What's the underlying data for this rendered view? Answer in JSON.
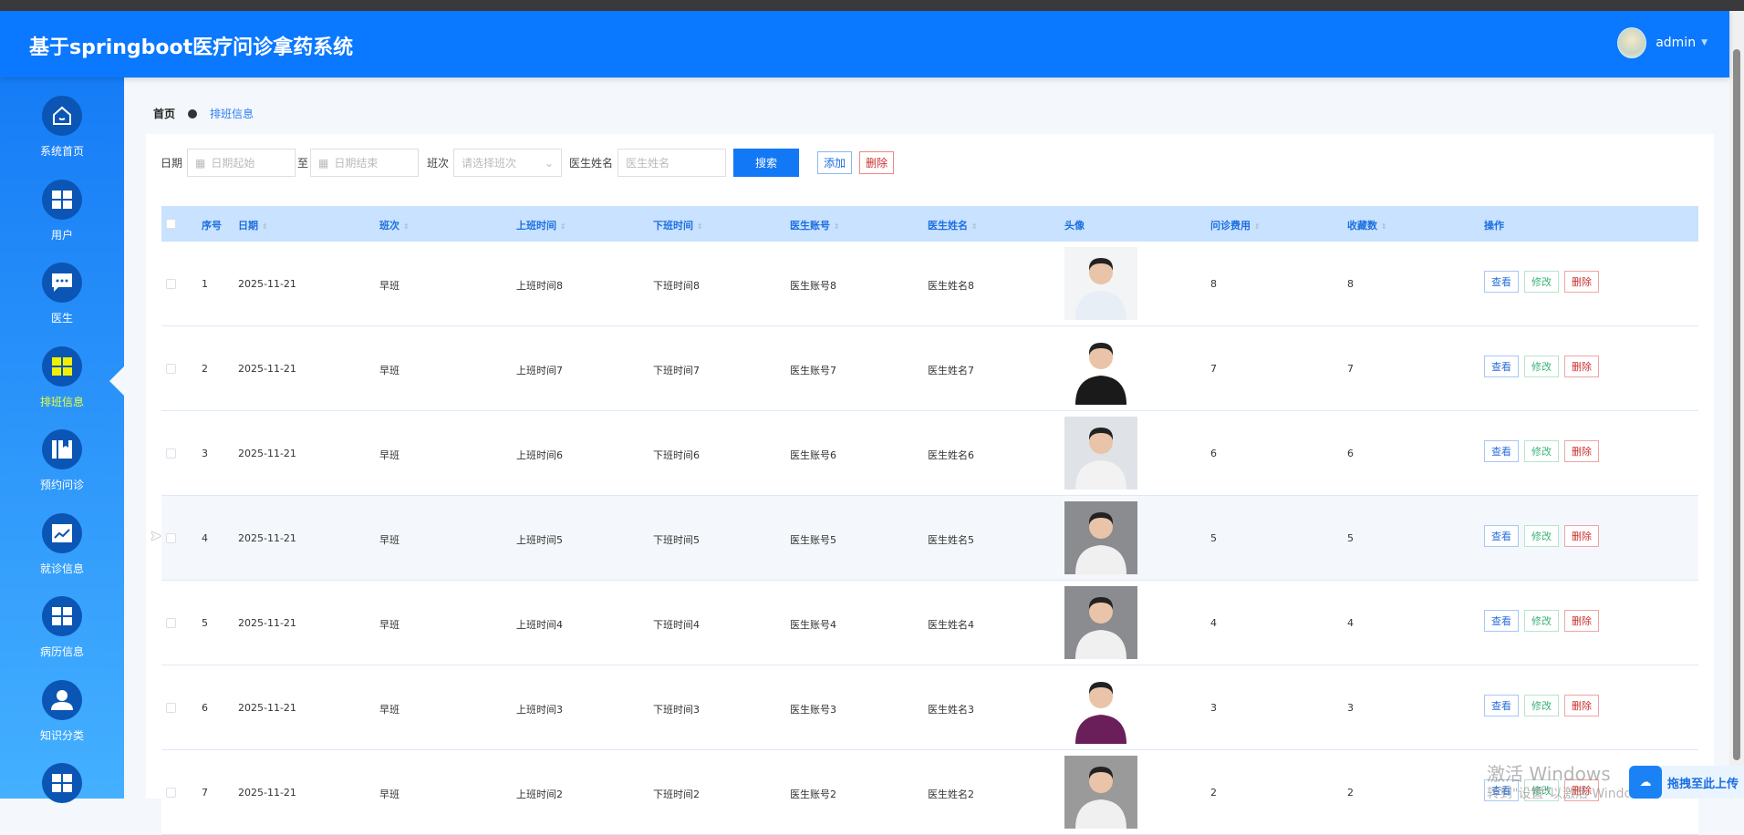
{
  "app_title": "基于springboot医疗问诊拿药系统",
  "user": {
    "name": "admin"
  },
  "sidebar": {
    "items": [
      {
        "label": "系统首页",
        "icon": "home-icon"
      },
      {
        "label": "用户",
        "icon": "grid-icon"
      },
      {
        "label": "医生",
        "icon": "chat-icon"
      },
      {
        "label": "排班信息",
        "icon": "grid-icon",
        "active": true
      },
      {
        "label": "预约问诊",
        "icon": "book-icon"
      },
      {
        "label": "就诊信息",
        "icon": "chart-icon"
      },
      {
        "label": "病历信息",
        "icon": "grid-icon"
      },
      {
        "label": "知识分类",
        "icon": "person-icon"
      },
      {
        "label": "",
        "icon": "grid-icon"
      }
    ]
  },
  "breadcrumb": {
    "home": "首页",
    "current": "排班信息"
  },
  "search": {
    "date_label": "日期",
    "date_start_placeholder": "日期起始",
    "to": "至",
    "date_end_placeholder": "日期结束",
    "shift_label": "班次",
    "shift_placeholder": "请选择班次",
    "doctor_label": "医生姓名",
    "doctor_placeholder": "医生姓名",
    "search_btn": "搜索",
    "add_btn": "添加",
    "delete_btn": "删除"
  },
  "table": {
    "headers": [
      "序号",
      "日期",
      "班次",
      "上班时间",
      "下班时间",
      "医生账号",
      "医生姓名",
      "头像",
      "问诊费用",
      "收藏数",
      "操作"
    ],
    "actions": {
      "view": "查看",
      "edit": "修改",
      "delete": "删除"
    },
    "rows": [
      [
        "1",
        "2025-11-21",
        "早班",
        "上班时间8",
        "下班时间8",
        "医生账号8",
        "医生姓名8",
        "8",
        "8"
      ],
      [
        "2",
        "2025-11-21",
        "早班",
        "上班时间7",
        "下班时间7",
        "医生账号7",
        "医生姓名7",
        "7",
        "7"
      ],
      [
        "3",
        "2025-11-21",
        "早班",
        "上班时间6",
        "下班时间6",
        "医生账号6",
        "医生姓名6",
        "6",
        "6"
      ],
      [
        "4",
        "2025-11-21",
        "早班",
        "上班时间5",
        "下班时间5",
        "医生账号5",
        "医生姓名5",
        "5",
        "5"
      ],
      [
        "5",
        "2025-11-21",
        "早班",
        "上班时间4",
        "下班时间4",
        "医生账号4",
        "医生姓名4",
        "4",
        "4"
      ],
      [
        "6",
        "2025-11-21",
        "早班",
        "上班时间3",
        "下班时间3",
        "医生账号3",
        "医生姓名3",
        "3",
        "3"
      ],
      [
        "7",
        "2025-11-21",
        "早班",
        "上班时间2",
        "下班时间2",
        "医生账号2",
        "医生姓名2",
        "2",
        "2"
      ]
    ]
  },
  "overlay": {
    "watermark1": "激活 Windows",
    "watermark2": "转到\"设置\"以激活 Windows。",
    "upload": "拖拽至此上传"
  },
  "colors": {
    "header": "#0a78ff",
    "active_nav": "#e8ff3b"
  }
}
